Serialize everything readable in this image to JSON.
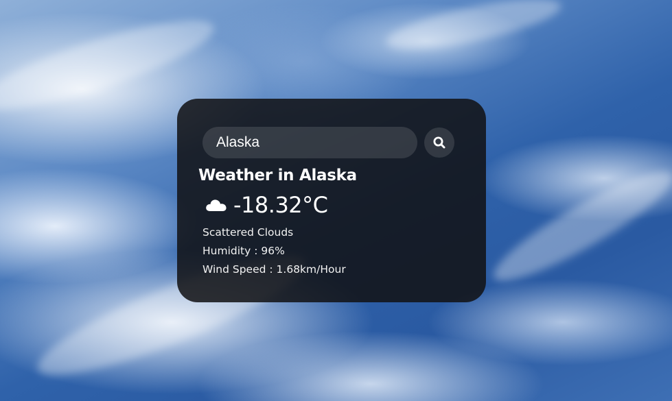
{
  "search": {
    "value": "Alaska",
    "icon": "search-icon"
  },
  "weather": {
    "title": "Weather in Alaska",
    "icon": "cloud-icon",
    "temperature": "-18.32°C",
    "description": "Scattered Clouds",
    "humidity": "Humidity : 96%",
    "wind": "Wind Speed : 1.68km/Hour"
  },
  "colors": {
    "card_bg": "#121214",
    "text": "#ffffff",
    "sky": "#2f62aa"
  }
}
